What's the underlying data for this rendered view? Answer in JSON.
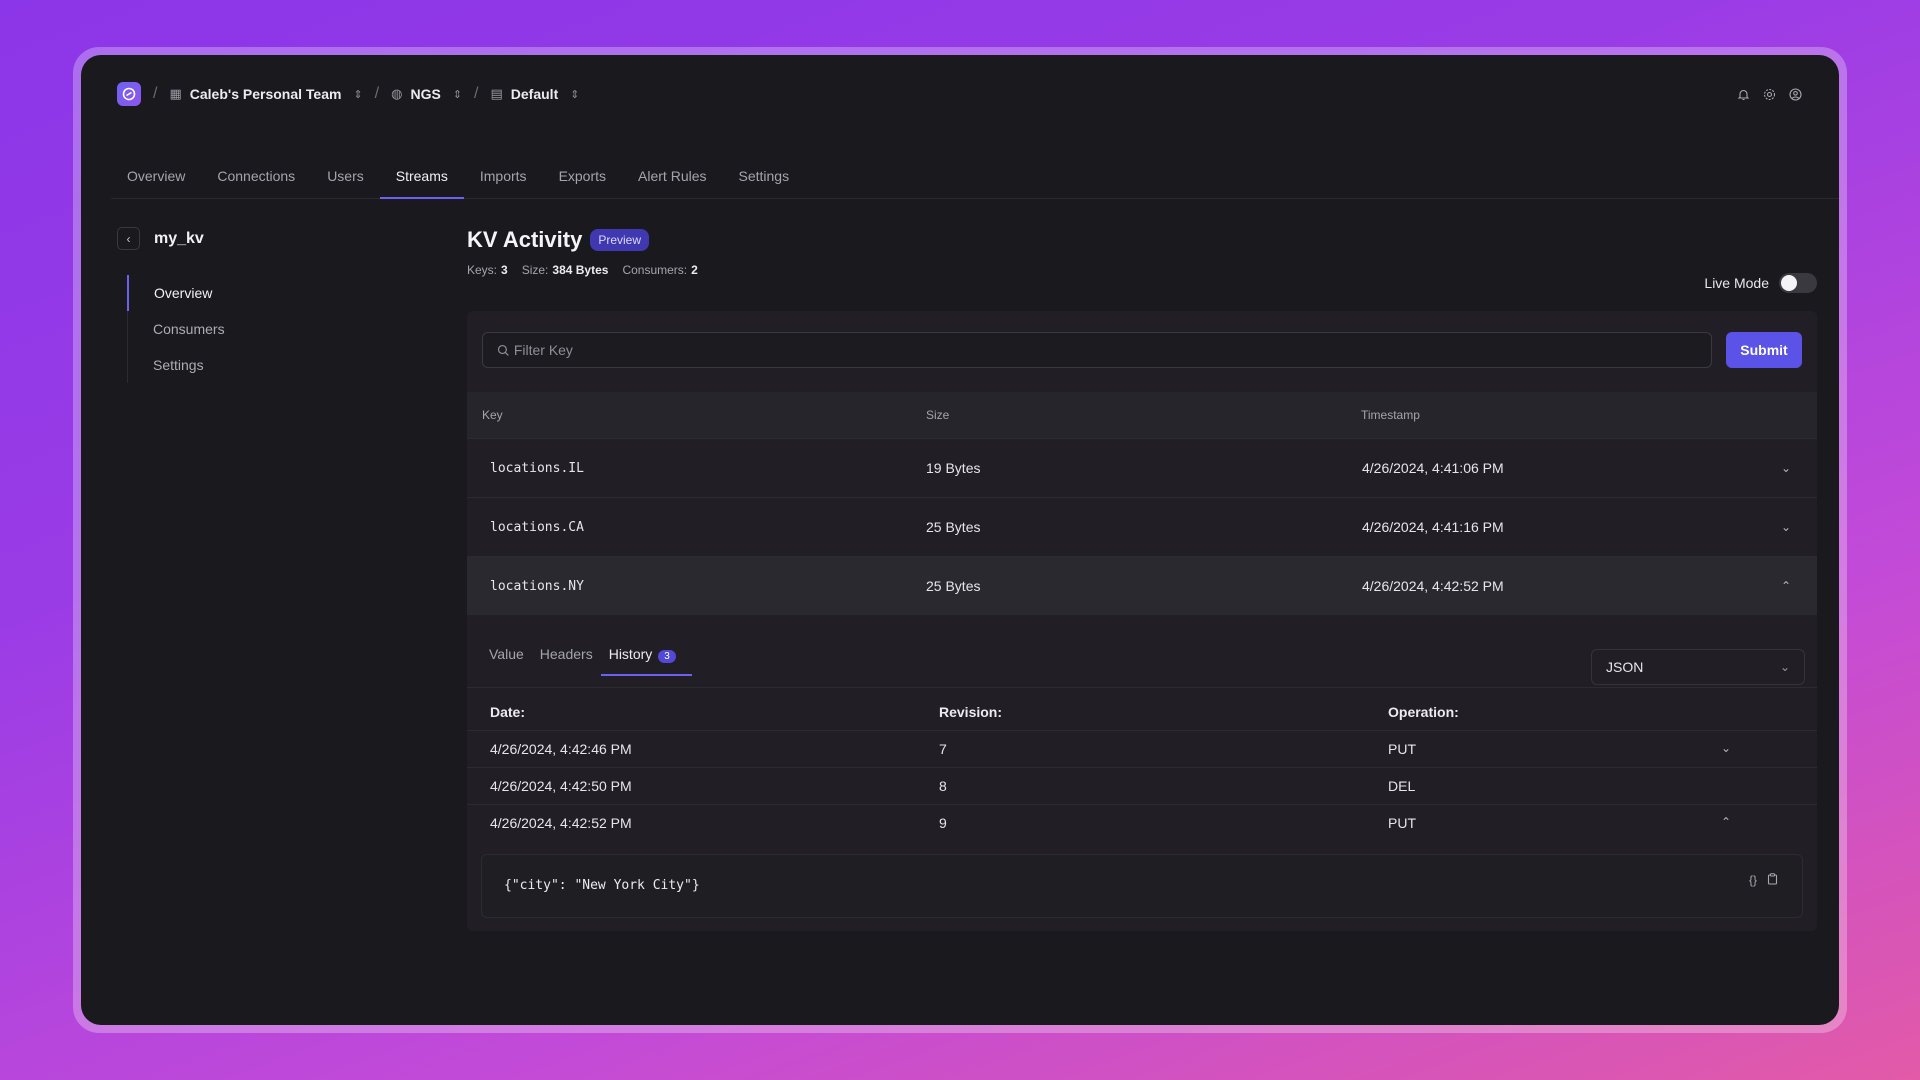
{
  "topbar": {
    "crumbs": [
      {
        "label": "Caleb's Personal Team",
        "icon": "grid-icon"
      },
      {
        "label": "NGS",
        "icon": "globe-icon"
      },
      {
        "label": "Default",
        "icon": "server-icon"
      }
    ],
    "separator": "/"
  },
  "tabs": [
    "Overview",
    "Connections",
    "Users",
    "Streams",
    "Imports",
    "Exports",
    "Alert Rules",
    "Settings"
  ],
  "active_tab": "Streams",
  "sidebar": {
    "title": "my_kv",
    "items": [
      "Overview",
      "Consumers",
      "Settings"
    ],
    "active": "Overview"
  },
  "main": {
    "title": "KV Activity",
    "badge": "Preview",
    "stats": {
      "keys_label": "Keys:",
      "keys_value": "3",
      "size_label": "Size:",
      "size_value": "384 Bytes",
      "consumers_label": "Consumers:",
      "consumers_value": "2"
    },
    "live_mode_label": "Live Mode",
    "live_mode_on": false,
    "filter_placeholder": "Filter Key",
    "submit_label": "Submit"
  },
  "table": {
    "headers": [
      "Key",
      "Size",
      "Timestamp"
    ],
    "rows": [
      {
        "key": "locations.IL",
        "size": "19 Bytes",
        "timestamp": "4/26/2024, 4:41:06 PM"
      },
      {
        "key": "locations.CA",
        "size": "25 Bytes",
        "timestamp": "4/26/2024, 4:41:16 PM"
      },
      {
        "key": "locations.NY",
        "size": "25 Bytes",
        "timestamp": "4/26/2024, 4:42:52 PM"
      }
    ]
  },
  "detail": {
    "tabs": [
      "Value",
      "Headers",
      "History"
    ],
    "active_tab": "History",
    "history_count": "3",
    "format": "JSON",
    "history_headers": [
      "Date:",
      "Revision:",
      "Operation:"
    ],
    "history_rows": [
      {
        "date": "4/26/2024, 4:42:46 PM",
        "revision": "7",
        "operation": "PUT"
      },
      {
        "date": "4/26/2024, 4:42:50 PM",
        "revision": "8",
        "operation": "DEL"
      },
      {
        "date": "4/26/2024, 4:42:52 PM",
        "revision": "9",
        "operation": "PUT"
      }
    ],
    "value": "{\"city\": \"New York City\"}"
  },
  "colors": {
    "accent": "#5b52e8",
    "background": "#1a191e",
    "panel": "#211f25"
  }
}
